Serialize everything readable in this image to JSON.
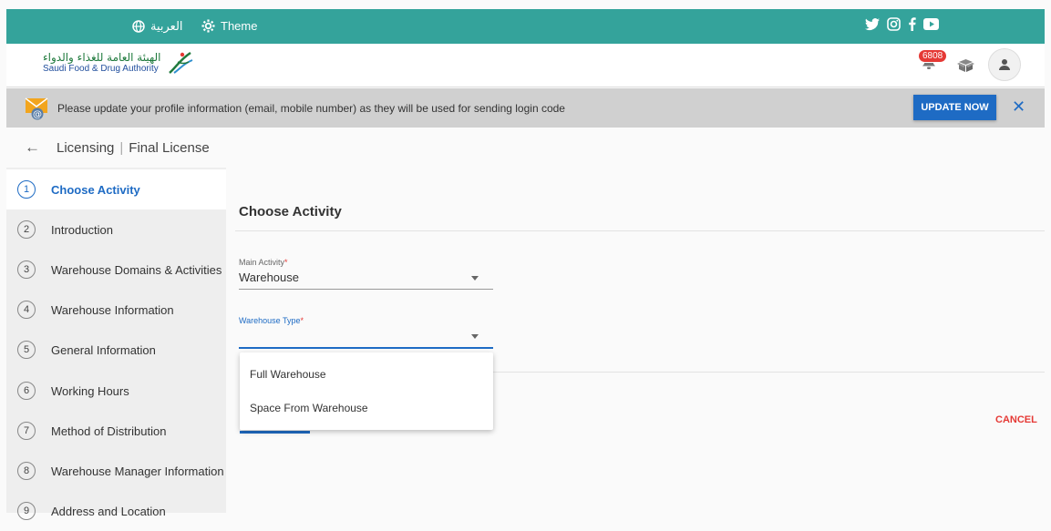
{
  "topbar": {
    "language": "العربية",
    "theme": "Theme",
    "social_icons": [
      "twitter-icon",
      "instagram-icon",
      "facebook-icon",
      "youtube-icon"
    ]
  },
  "brand": {
    "logo_arabic": "الهيئة العامة للغذاء والدواء",
    "logo_english": "Saudi Food & Drug Authority",
    "notification_count": "6808"
  },
  "notice": {
    "message": "Please update your profile information (email, mobile number) as they will be used for sending login code",
    "button": "UPDATE NOW",
    "close": "✕"
  },
  "breadcrumb": {
    "back": "←",
    "section": "Licensing",
    "separator": "|",
    "page": "Final License"
  },
  "steps": [
    {
      "num": "1",
      "label": "Choose Activity",
      "active": true
    },
    {
      "num": "2",
      "label": "Introduction"
    },
    {
      "num": "3",
      "label": "Warehouse Domains & Activities"
    },
    {
      "num": "4",
      "label": "Warehouse Information"
    },
    {
      "num": "5",
      "label": "General Information"
    },
    {
      "num": "6",
      "label": "Working Hours"
    },
    {
      "num": "7",
      "label": "Method of Distribution"
    },
    {
      "num": "8",
      "label": "Warehouse Manager Information"
    },
    {
      "num": "9",
      "label": "Address and Location"
    }
  ],
  "main": {
    "title": "Choose Activity",
    "main_activity_label": "Main Activity",
    "main_activity_value": "Warehouse",
    "warehouse_type_label": "Warehouse Type",
    "warehouse_type_value": "",
    "required_mark": "*",
    "cancel": "CANCEL",
    "options": [
      "Full Warehouse",
      "Space From Warehouse"
    ]
  },
  "colors": {
    "topbar": "#34a39b",
    "accent": "#1e6bc4",
    "danger": "#e53935"
  }
}
